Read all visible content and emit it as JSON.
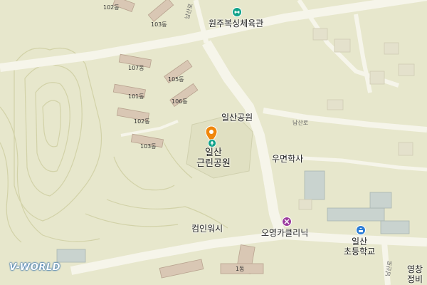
{
  "buildings": {
    "b102_top": "102동",
    "b103_top": "103동",
    "b107": "107동",
    "b105": "105동",
    "b101": "101동",
    "b106": "106동",
    "b102": "102동",
    "b103": "103동",
    "b1": "1동"
  },
  "roads": {
    "namsan_top": "남산로",
    "namsan": "남산로",
    "namsan_bottom": "남산로"
  },
  "pois": {
    "sports_center": "원주복싱체육관",
    "ilsan_park": "일산공원",
    "park_line1": "일산",
    "park_line2": "근린공원",
    "umyeon_academy": "우면학사",
    "coin_wash": "컴인워시",
    "oyoung_clinic": "오영카클리닉",
    "school_line1": "일산",
    "school_line2": "초등학교",
    "yeongchang_line1": "영창",
    "yeongchang_line2": "정비"
  },
  "icons": {
    "sports_center": "sports-center-icon",
    "marker": "location-marker-icon",
    "park": "park-icon",
    "clinic": "clinic-icon",
    "school": "school-icon"
  },
  "colors": {
    "map_background": "#e7e7cc",
    "road": "#f6f5ea",
    "marker": "#f0860c",
    "sports_icon": "#12a38a",
    "clinic_icon": "#9b3b9e",
    "school_icon": "#2c7dd6",
    "logo": "#1a5fa8"
  },
  "logo": {
    "text": "V-WORLD"
  }
}
